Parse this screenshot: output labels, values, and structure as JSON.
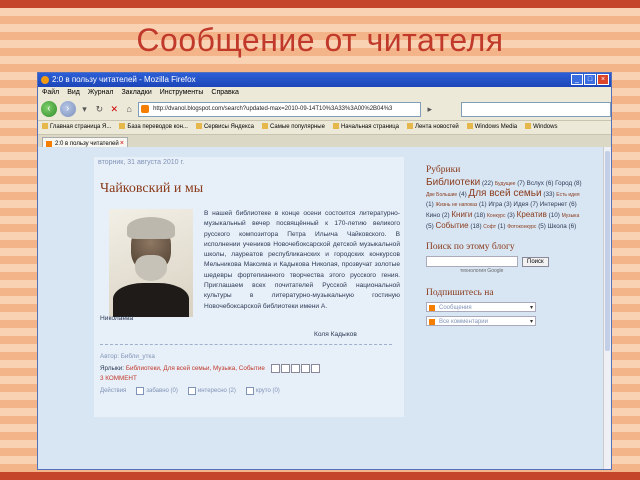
{
  "slide": {
    "title": "Сообщение от читателя"
  },
  "window": {
    "title": "2:0 в пользу читателей - Mozilla Firefox",
    "menu": [
      "Файл",
      "Вид",
      "Журнал",
      "Закладки",
      "Инструменты",
      "Справка"
    ],
    "url": "http://dvanol.blogspot.com/search?updated-max=2010-09-14T10%3A33%3A00%2B04%3",
    "bookmarks": [
      "Главная страница Я...",
      "База переводов кон...",
      "Сервисы Яндекса",
      "Самые популярные",
      "Начальная страница",
      "Лента новостей",
      "Windows Media",
      "Windows"
    ],
    "tab_label": "2:0 в пользу читателей"
  },
  "post": {
    "date": "вторник, 31 августа 2010 г.",
    "title": "Чайковский и мы",
    "body": "В нашей библиотеке в конце осени состоится литературно-музыкальный вечер посвящённый к 170-летию великого русского композитора Петра Ильича Чайковского. В исполнении учеников Новочебоксарской детской музыкальной школы, лауреатов республиканских и городских конкурсов Мельникова Максима и Кадыкова Николая, прозвучат золотые шедевры фортепианного творчества этого русского гения. Приглашаем всех почитателей Русской национальной культуры в литературно-музыкальную гостиную Новочебоксарской библиотеки имени А.",
    "tail": "Николаева",
    "signature": "Коля Кадыков",
    "author_line": "Автор: Библи_утка",
    "labels_prefix": "Ярлыки:",
    "labels": "Библиотеки, Для всей семьи, Музыка, Событие",
    "comments": "3 КОММЕНТ",
    "actions_label": "Действия",
    "actions": [
      "забавно (0)",
      "интересно (2)",
      "круто (0)"
    ]
  },
  "sidebar": {
    "rubrics_title": "Рубрики",
    "search_title": "Поиск по этому блогу",
    "search_button": "Поиск",
    "powered": "технология Google",
    "subscribe_title": "Подпишитесь на",
    "feeds": [
      "Сообщения",
      "Все комментарии"
    ]
  },
  "colors": {
    "accent": "#8a3a1a",
    "title_red": "#c0392b",
    "page_bg": "#d8e6f4"
  }
}
